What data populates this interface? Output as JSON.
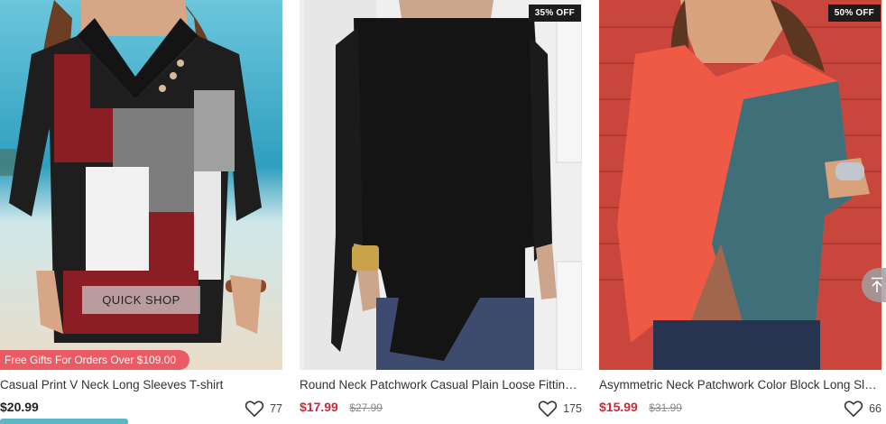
{
  "products": [
    {
      "title": "Casual Print V Neck Long Sleeves T-shirt",
      "price": "$20.99",
      "original_price": "",
      "wishlist_count": "77",
      "badge": "",
      "quick_shop_label": "QUICK SHOP",
      "promo_banner": "Free Gifts For Orders Over $109.00"
    },
    {
      "title": "Round Neck Patchwork Casual Plain Loose Fitting Long Sleeve T-shirt",
      "price": "$17.99",
      "original_price": "$27.99",
      "wishlist_count": "175",
      "badge": "35% OFF"
    },
    {
      "title": "Asymmetric Neck Patchwork Color Block Long Sleeve T-shirt",
      "price": "$15.99",
      "original_price": "$31.99",
      "wishlist_count": "66",
      "badge": "50% OFF"
    }
  ],
  "colors": {
    "sale_price": "#d32636",
    "badge_bg": "#1c1c1c",
    "promo_banner_bg": "#ec5b63",
    "accent_strip": "#5bb8c4"
  },
  "icons": {
    "wishlist": "heart-outline-icon",
    "back_to_top": "arrow-up-to-line-icon"
  }
}
